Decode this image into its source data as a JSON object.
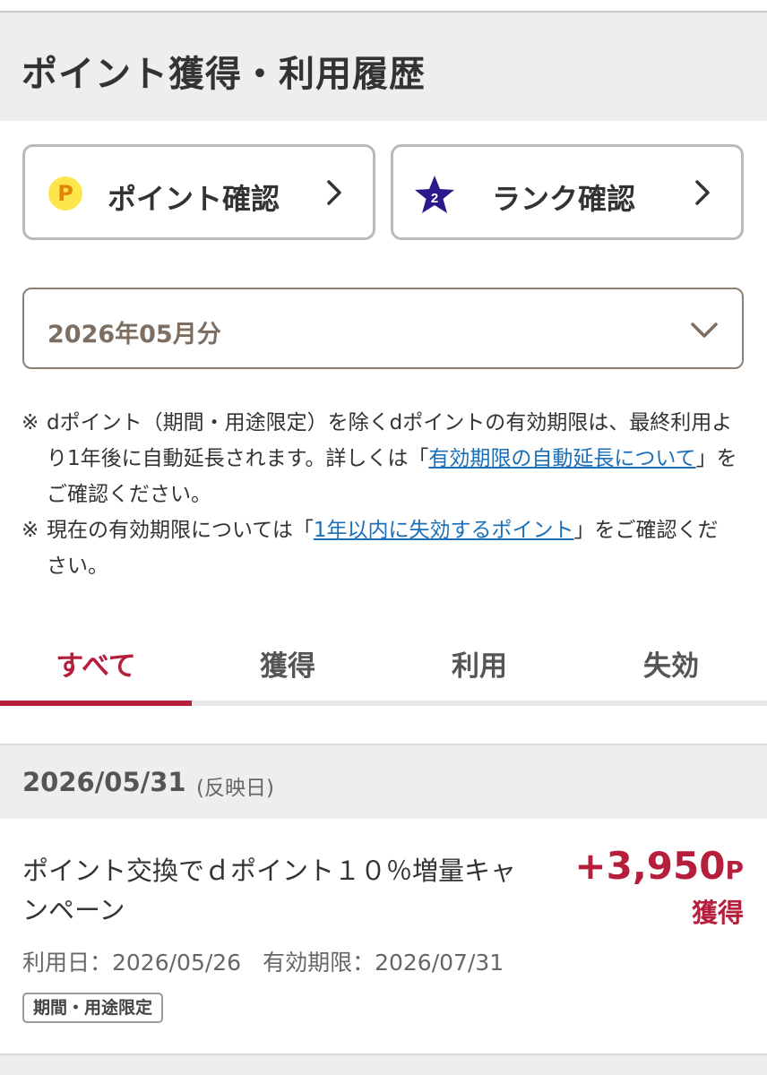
{
  "header": {
    "title": "ポイント獲得・利用履歴"
  },
  "nav": {
    "point_button": {
      "icon": "point-coin-icon",
      "icon_text": "P",
      "label": "ポイント確認"
    },
    "rank_button": {
      "icon": "rank-star-icon",
      "icon_text": "2",
      "label": "ランク確認"
    }
  },
  "month_select": {
    "value": "2026年05月分"
  },
  "notes": {
    "note1": {
      "mark": "※",
      "text_before": "dポイント（期間・用途限定）を除くdポイントの有効期限は、最終利用より1年後に自動延長されます。詳しくは「",
      "link": "有効期限の自動延長について",
      "text_after": "」をご確認ください。"
    },
    "note2": {
      "mark": "※",
      "text_before": "現在の有効期限については「",
      "link": "1年以内に失効するポイント",
      "text_after": "」をご確認ください。"
    }
  },
  "tabs": [
    {
      "label": "すべて",
      "active": true
    },
    {
      "label": "獲得",
      "active": false
    },
    {
      "label": "利用",
      "active": false
    },
    {
      "label": "失効",
      "active": false
    }
  ],
  "history": {
    "date": "2026/05/31",
    "date_note": "(反映日)",
    "entry": {
      "title": "ポイント交換でｄポイント１０％増量キャンペーン",
      "amount": "+3,950",
      "unit": "P",
      "status": "獲得",
      "use_date": "利用日：2026/05/26",
      "expiry": "有効期限：2026/07/31",
      "badge": "期間・用途限定"
    }
  },
  "colors": {
    "accent": "#b61f3c",
    "link": "#1a6fb8",
    "coin": "#fde64a",
    "star": "#2c1a8c"
  }
}
